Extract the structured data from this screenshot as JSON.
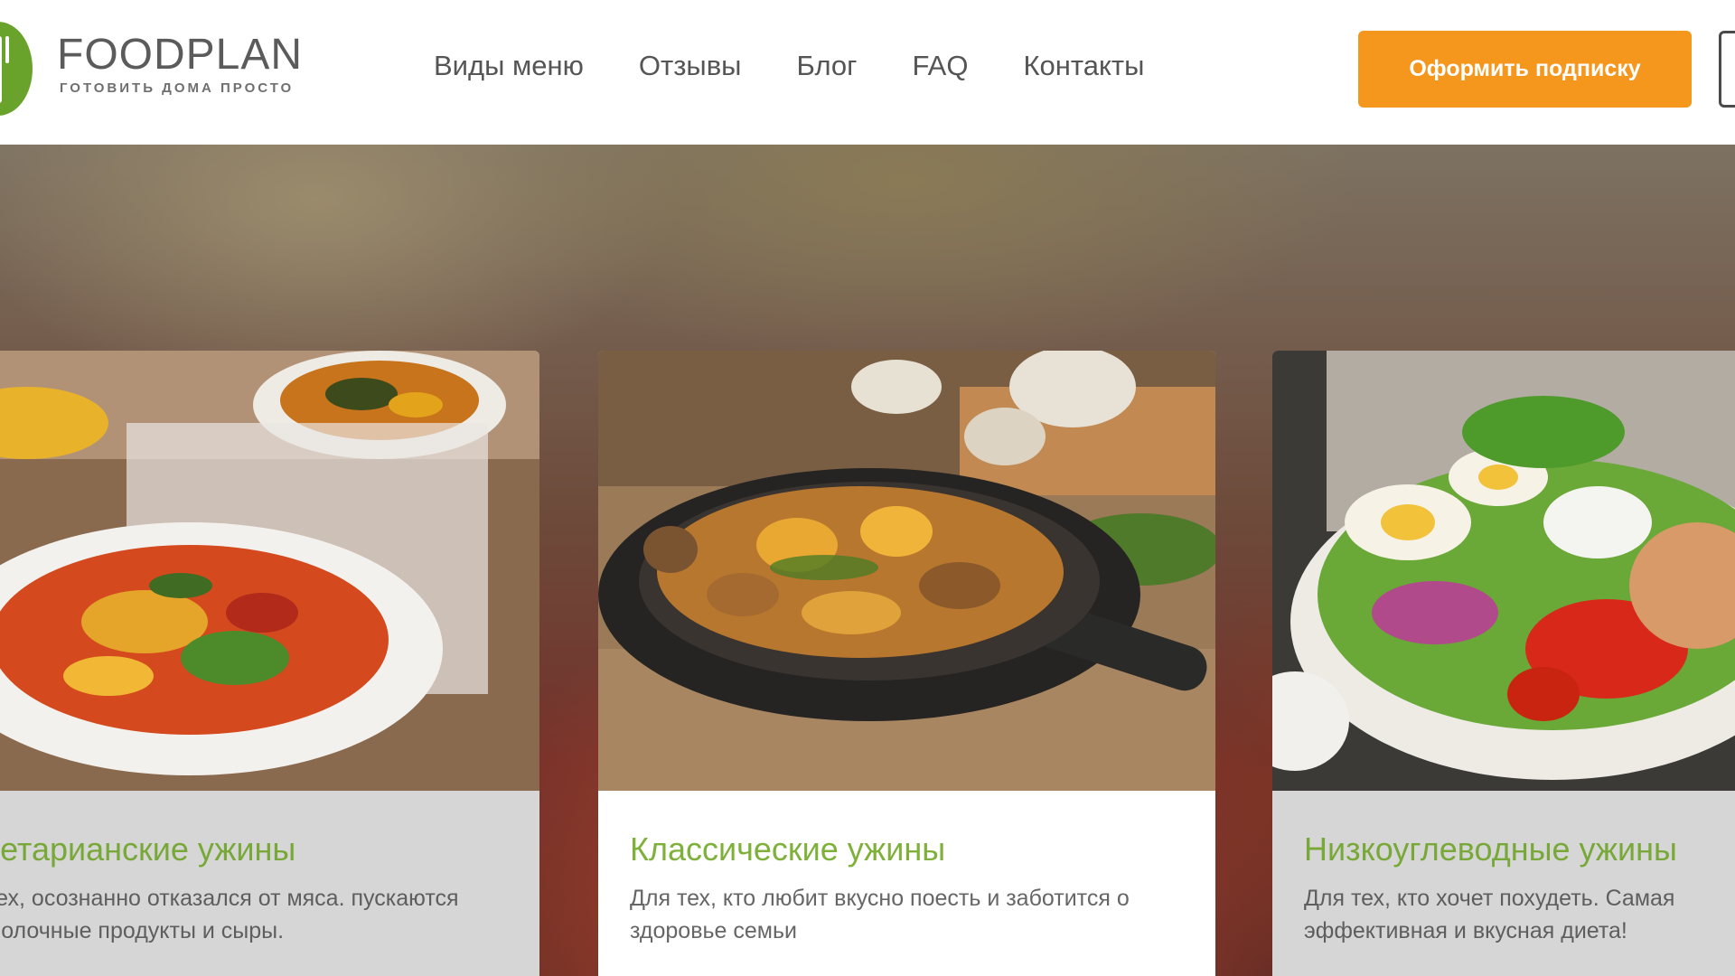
{
  "header": {
    "logo_title": "FOODPLAN",
    "logo_subtitle": "ГОТОВИТЬ ДОМА ПРОСТО",
    "nav": [
      "Виды меню",
      "Отзывы",
      "Блог",
      "FAQ",
      "Контакты"
    ],
    "cta_label": "Оформить подписку"
  },
  "cards": [
    {
      "title": "тетарианские ужины",
      "description": "тех, осознанно отказался от мяса. пускаются молочные продукты и сыры."
    },
    {
      "title": "Классические ужины",
      "description": "Для тех, кто любит вкусно поесть и заботится о здоровье семьи"
    },
    {
      "title": "Низкоуглеводные ужины",
      "description": "Для тех, кто хочет похудеть. Самая эффективная и вкусная диета!"
    }
  ],
  "slider": {
    "dots_total": 3,
    "active_index": 0
  },
  "colors": {
    "accent_orange": "#f5961d",
    "title_green": "#7fb13a",
    "logo_green": "#6aa32b"
  },
  "icons": {
    "logo": "fork-knife-leaf-icon"
  }
}
